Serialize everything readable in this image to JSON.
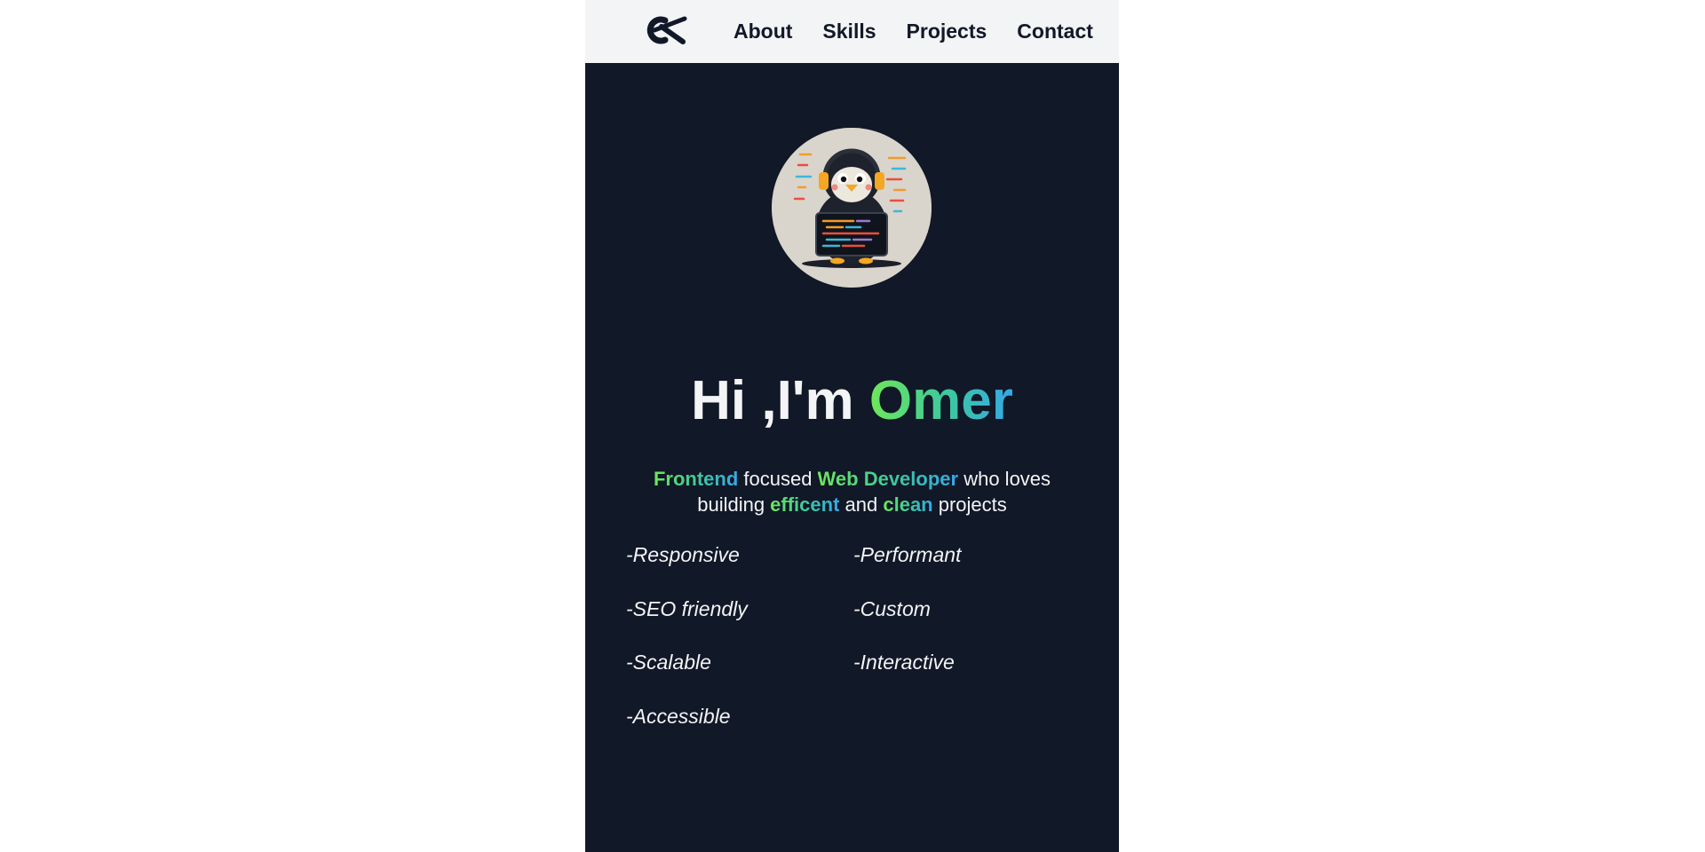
{
  "nav": {
    "logo_icon": "ok-monogram-logo-icon",
    "links": [
      {
        "label": "About"
      },
      {
        "label": "Skills"
      },
      {
        "label": "Projects"
      },
      {
        "label": "Contact"
      }
    ]
  },
  "hero": {
    "avatar_icon": "penguin-coder-avatar-icon",
    "headline_prefix": "Hi ,I'm ",
    "headline_name": "Omer",
    "tagline": {
      "w1": "Frontend",
      "t1": " focused ",
      "w2": "Web Developer",
      "t2": " who loves building ",
      "w3": "efficent",
      "t3": " and ",
      "w4": "clean",
      "t4": " projects"
    },
    "features_left": [
      "-Responsive",
      "-SEO friendly",
      "-Scalable",
      "-Accessible"
    ],
    "features_right": [
      "-Performant",
      "-Custom",
      "-Interactive"
    ]
  },
  "colors": {
    "nav_bg": "#f3f4f6",
    "page_bg": "#111827",
    "text": "#f3f4f6",
    "accent_green": "#6ee85a",
    "accent_blue": "#35a8ea"
  }
}
